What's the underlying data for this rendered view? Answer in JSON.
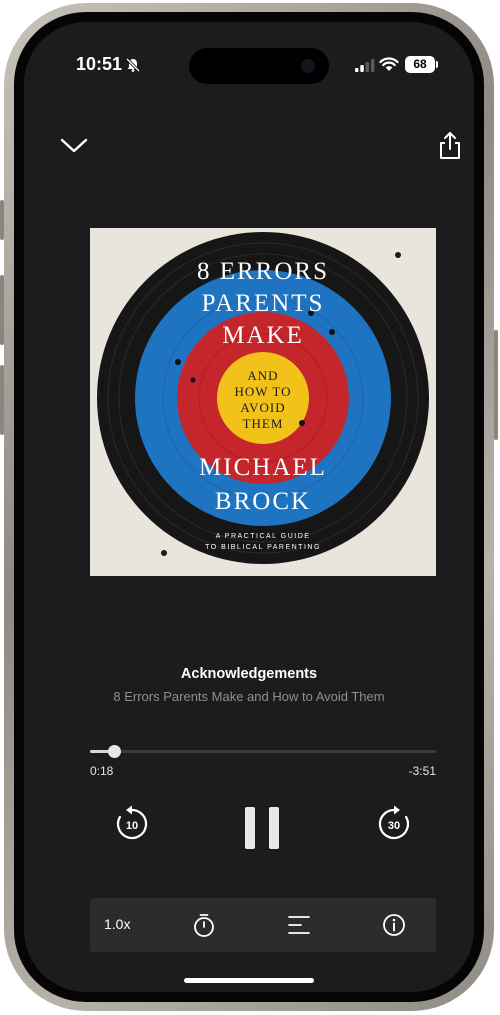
{
  "status_bar": {
    "time": "10:51",
    "battery": "68"
  },
  "player": {
    "chapter_title": "Acknowledgements",
    "book_title": "8 Errors Parents Make and How to Avoid Them",
    "elapsed": "0:18",
    "remaining": "-3:51",
    "progress_fraction": 0.07,
    "skip_back_seconds": "10",
    "skip_forward_seconds": "30",
    "speed": "1.0x"
  },
  "cover": {
    "line1": "8 ERRORS",
    "line2": "PARENTS",
    "line3": "MAKE",
    "center1": "AND",
    "center2": "HOW TO",
    "center3": "AVOID",
    "center4": "THEM",
    "author1": "MICHAEL",
    "author2": "BROCK",
    "tag1": "A PRACTICAL GUIDE",
    "tag2": "TO BIBLICAL PARENTING"
  },
  "icons": [
    "collapse-chevron-icon",
    "share-icon",
    "skip-back-icon",
    "pause-icon",
    "skip-forward-icon",
    "sleep-timer-icon",
    "chapters-icon",
    "info-icon",
    "mute-bell-icon",
    "signal-icon",
    "wifi-icon",
    "battery-icon"
  ],
  "colors": {
    "background": "#1c1c1e",
    "toolbar": "#2c2c2e",
    "subtitle": "#8e8e93",
    "target_black": "#161616",
    "target_blue": "#1f74c2",
    "target_red": "#c5262b",
    "target_yellow": "#f2c21b"
  }
}
